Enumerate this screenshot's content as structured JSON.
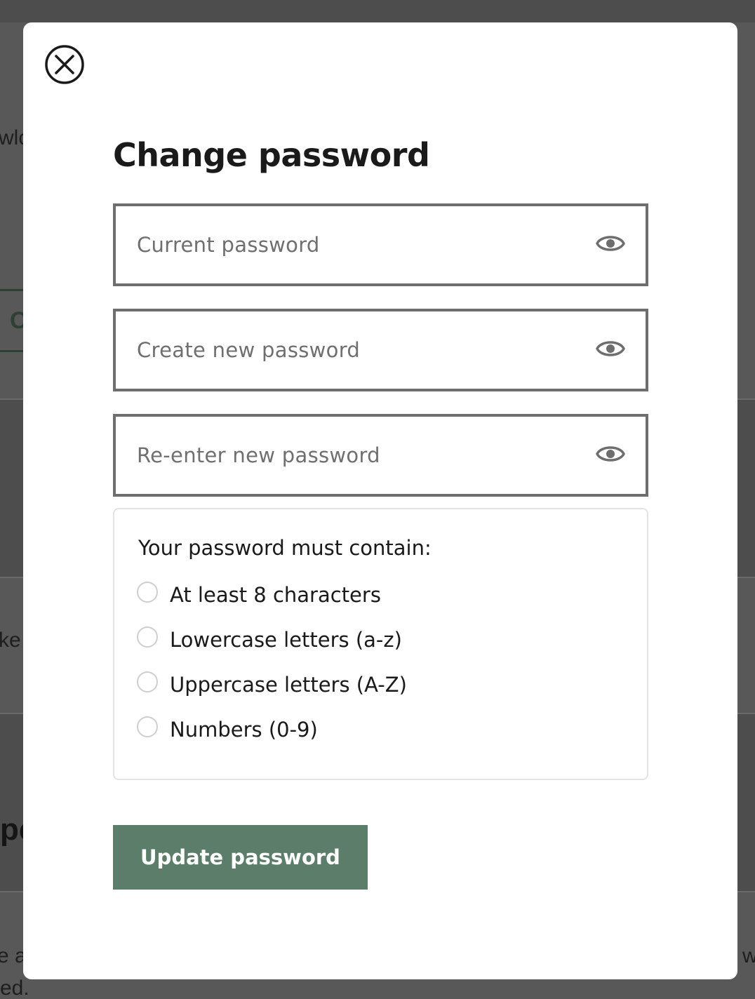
{
  "background": {
    "fragments": [
      "wlc",
      "C",
      "ke",
      "pe",
      "e a",
      "ed.",
      "w"
    ]
  },
  "modal": {
    "close_icon": "close-circle-icon",
    "title": "Change password",
    "fields": [
      {
        "placeholder": "Current password",
        "value": "",
        "icon": "eye-icon"
      },
      {
        "placeholder": "Create new password",
        "value": "",
        "icon": "eye-icon"
      },
      {
        "placeholder": "Re-enter new password",
        "value": "",
        "icon": "eye-icon"
      }
    ],
    "requirements": {
      "title": "Your password must contain:",
      "items": [
        {
          "label": "At least 8 characters",
          "met": false
        },
        {
          "label": "Lowercase letters (a-z)",
          "met": false
        },
        {
          "label": "Uppercase letters (A-Z)",
          "met": false
        },
        {
          "label": "Numbers (0-9)",
          "met": false
        }
      ]
    },
    "submit_label": "Update password"
  },
  "colors": {
    "overlay": "#585858",
    "primary_button": "#5b7d69",
    "field_border": "#6e6e6e",
    "placeholder_text": "#6f6f6f"
  }
}
